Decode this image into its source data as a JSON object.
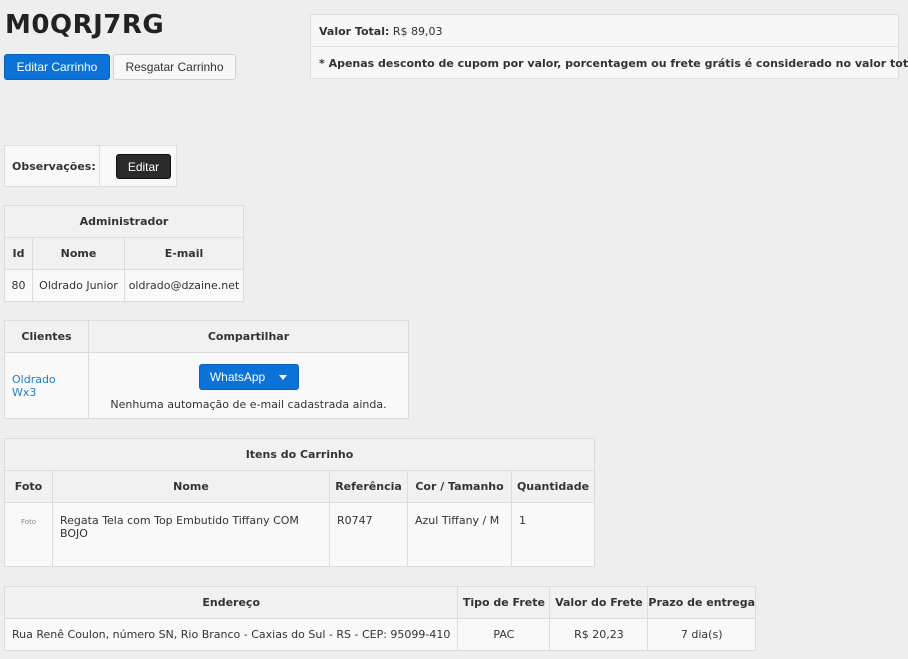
{
  "cart": {
    "code": "M0QRJ7RG",
    "edit_button": "Editar Carrinho",
    "rescue_button": "Resgatar Carrinho"
  },
  "summary": {
    "total_label": "Valor Total:",
    "total_value": "R$ 89,03",
    "note": "* Apenas desconto de cupom por valor, porcentagem ou frete grátis é considerado no valor total."
  },
  "observations": {
    "label": "Observações:",
    "edit_button": "Editar"
  },
  "admin": {
    "title": "Administrador",
    "columns": [
      "Id",
      "Nome",
      "E-mail"
    ],
    "row": [
      "80",
      "Oldrado Junior",
      "oldrado@dzaine.net"
    ]
  },
  "clients": {
    "col_clients": "Clientes",
    "col_share": "Compartilhar",
    "client_name": "Oldrado Wx3",
    "share_button": "WhatsApp",
    "no_automation": "Nenhuma automação de e-mail cadastrada ainda."
  },
  "items": {
    "title": "Itens do Carrinho",
    "columns": [
      "Foto",
      "Nome",
      "Referência",
      "Cor / Tamanho",
      "Quantidade"
    ],
    "rows": [
      {
        "photo": "Foto",
        "name": "Regata Tela com Top Embutido Tiffany COM BOJO",
        "ref": "R0747",
        "color_size": "Azul Tiffany / M",
        "qty": "1"
      }
    ]
  },
  "shipping": {
    "columns": [
      "Endereço",
      "Tipo de Frete",
      "Valor do Frete",
      "Prazo de entrega"
    ],
    "row": [
      "Rua Renê Coulon, número SN, Rio Branco - Caxias do Sul - RS - CEP: 95099-410",
      "PAC",
      "R$ 20,23",
      "7 dia(s)"
    ]
  }
}
